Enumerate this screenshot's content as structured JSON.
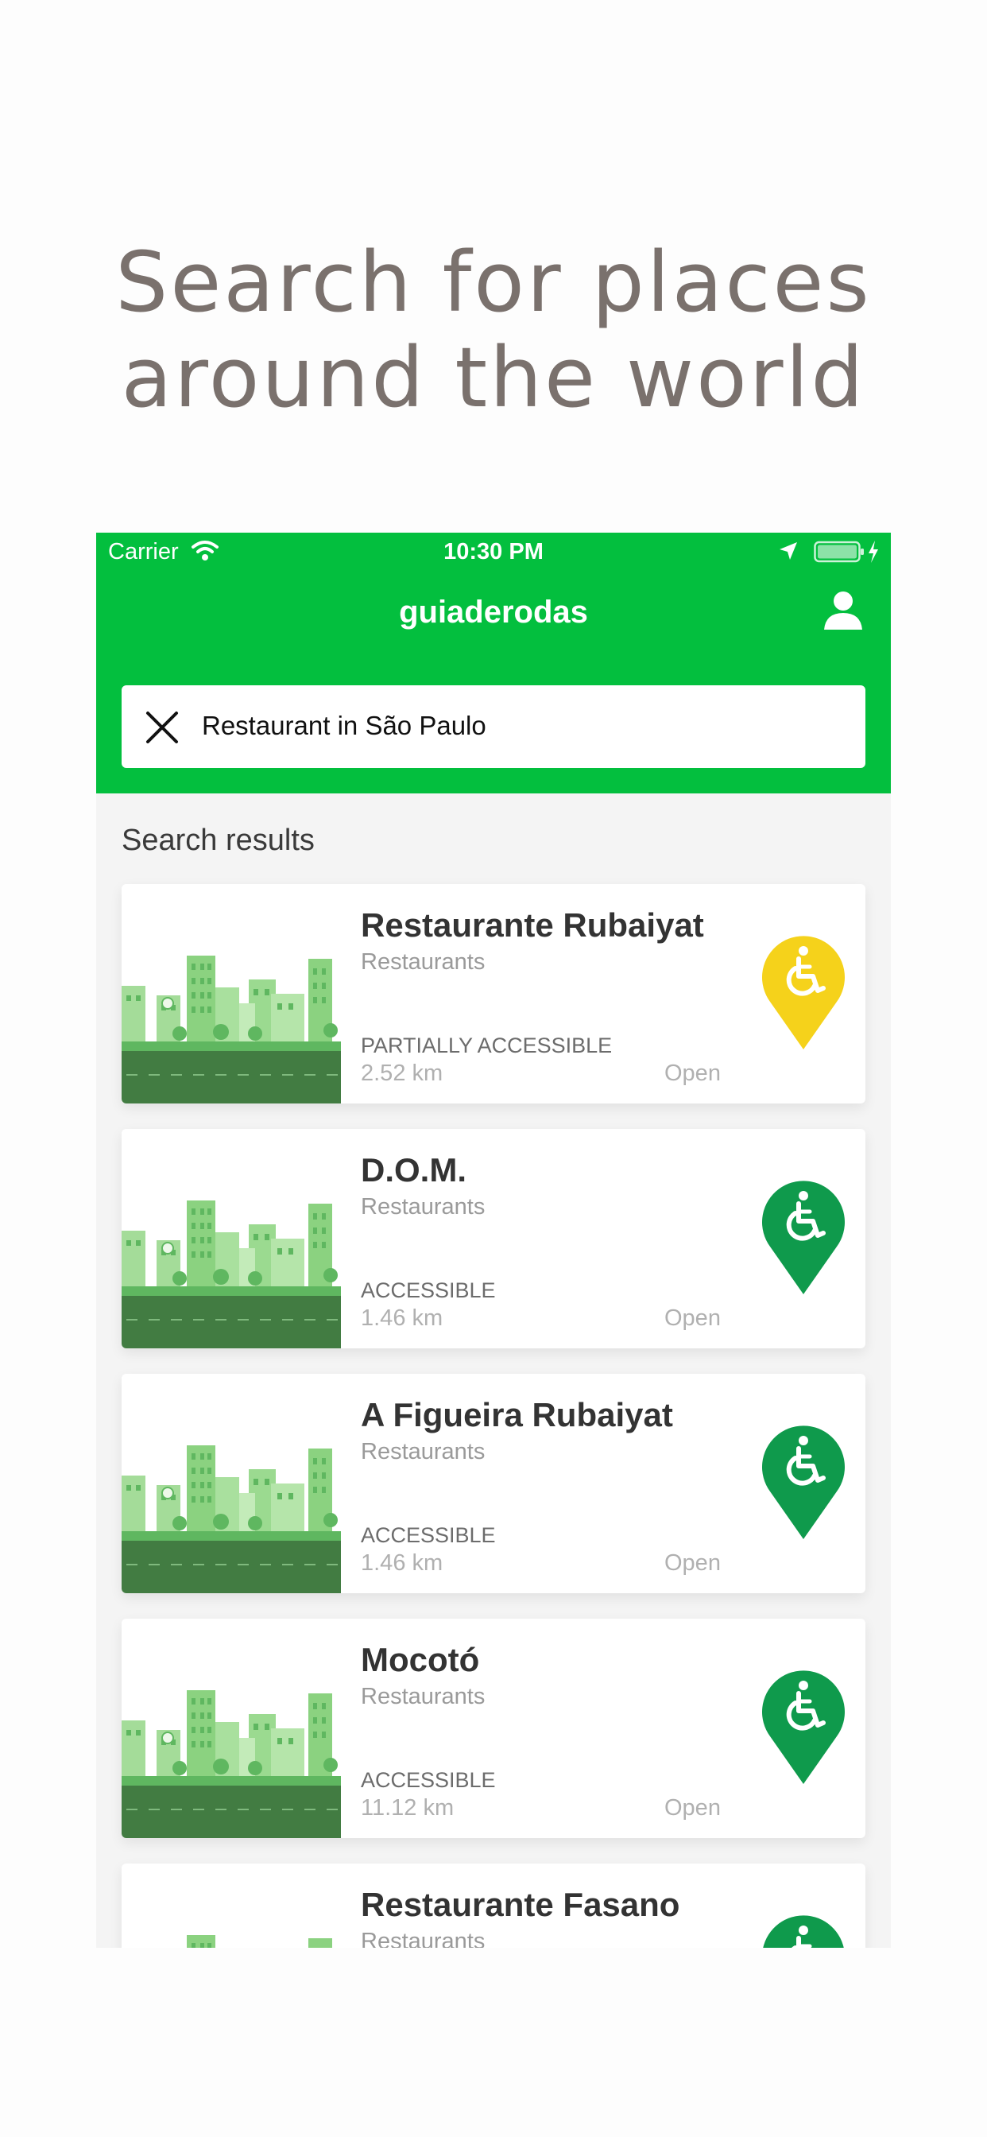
{
  "headline": {
    "line1": "Search for places",
    "line2": "around the world"
  },
  "status_bar": {
    "carrier": "Carrier",
    "time": "10:30 PM",
    "icons": [
      "wifi-icon",
      "location-arrow-icon",
      "battery-icon",
      "charging-bolt-icon"
    ]
  },
  "nav": {
    "title": "guiaderodas",
    "profile_icon": "person-icon"
  },
  "search": {
    "value": "Restaurant in São Paulo",
    "clear_icon": "close-icon"
  },
  "results": {
    "title": "Search results",
    "items": [
      {
        "name": "Restaurante Rubaiyat",
        "category": "Restaurants",
        "accessibility": "PARTIALLY ACCESSIBLE",
        "distance": "2.52 km",
        "status": "Open",
        "pin_color": "#f5d21b"
      },
      {
        "name": "D.O.M.",
        "category": "Restaurants",
        "accessibility": "ACCESSIBLE",
        "distance": "1.46 km",
        "status": "Open",
        "pin_color": "#0f9a4c"
      },
      {
        "name": "A Figueira Rubaiyat",
        "category": "Restaurants",
        "accessibility": "ACCESSIBLE",
        "distance": "1.46 km",
        "status": "Open",
        "pin_color": "#0f9a4c"
      },
      {
        "name": "Mocotó",
        "category": "Restaurants",
        "accessibility": "ACCESSIBLE",
        "distance": "11.12 km",
        "status": "Open",
        "pin_color": "#0f9a4c"
      },
      {
        "name": "Restaurante Fasano",
        "category": "Restaurants",
        "accessibility": "",
        "distance": "",
        "status": "",
        "pin_color": "#0f9a4c"
      }
    ]
  },
  "colors": {
    "brand_green": "#03bf3e",
    "headline_gray": "#7a716d",
    "partial_yellow": "#f5d21b",
    "accessible_green": "#0f9a4c"
  }
}
